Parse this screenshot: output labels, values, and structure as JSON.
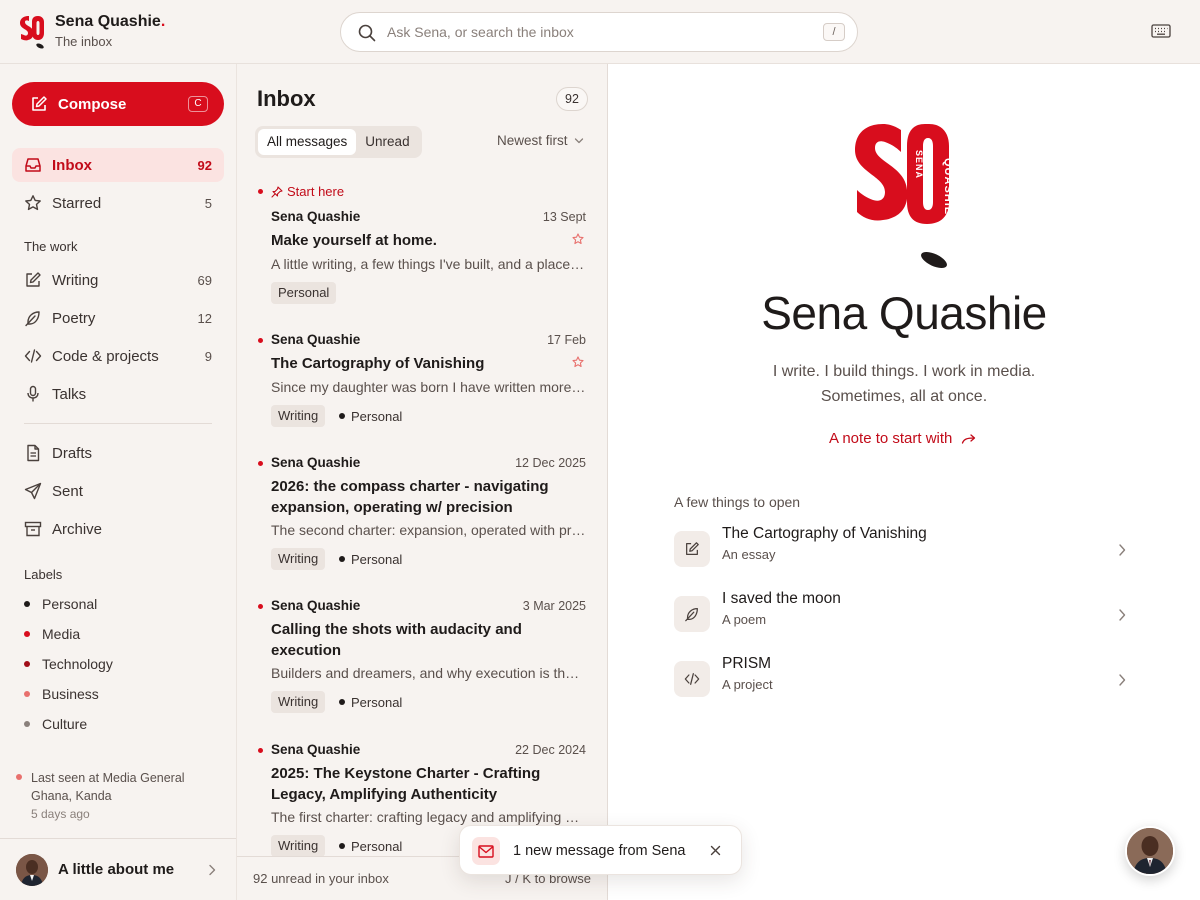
{
  "brand": {
    "name": "Sena Quashie",
    "name_suffix": ".",
    "subtitle": "The inbox",
    "logo_icon": "sq-logo",
    "accent_color": "#d80d1d"
  },
  "search": {
    "placeholder": "Ask Sena, or search the inbox",
    "shortcut": "/"
  },
  "sidebar": {
    "compose_label": "Compose",
    "compose_shortcut": "C",
    "primary": [
      {
        "label": "Inbox",
        "count": "92",
        "icon": "inbox-icon",
        "active": true
      },
      {
        "label": "Starred",
        "count": "5",
        "icon": "star-icon"
      }
    ],
    "work_title": "The work",
    "work": [
      {
        "label": "Writing",
        "count": "69",
        "icon": "pen-icon"
      },
      {
        "label": "Poetry",
        "count": "12",
        "icon": "feather-icon"
      },
      {
        "label": "Code & projects",
        "count": "9",
        "icon": "code-icon"
      },
      {
        "label": "Talks",
        "count": "",
        "icon": "mic-icon"
      }
    ],
    "folders": [
      {
        "label": "Drafts",
        "icon": "file-icon"
      },
      {
        "label": "Sent",
        "icon": "send-icon"
      },
      {
        "label": "Archive",
        "icon": "archive-icon"
      }
    ],
    "labels_title": "Labels",
    "labels": [
      {
        "label": "Personal",
        "color": "#1f1b1a"
      },
      {
        "label": "Media",
        "color": "#d80d1d"
      },
      {
        "label": "Technology",
        "color": "#a10d18"
      },
      {
        "label": "Business",
        "color": "#e8706d"
      },
      {
        "label": "Culture",
        "color": "#8a807b"
      }
    ],
    "last_seen": "Last seen at Media General Ghana, Kanda",
    "last_seen_ago": "5 days ago",
    "about_label": "A little about me"
  },
  "inbox": {
    "title": "Inbox",
    "count": "92",
    "filters": [
      "All messages",
      "Unread"
    ],
    "sort_label": "Newest first",
    "messages": [
      {
        "pin": "Start here",
        "from": "Sena Quashie",
        "date": "13 Sept",
        "subject": "Make yourself at home.",
        "preview": "A little writing, a few things I've built, and a place to start.",
        "starred": true,
        "tags": [
          "Personal"
        ],
        "dot_tags": []
      },
      {
        "from": "Sena Quashie",
        "date": "17 Feb",
        "subject": "The Cartography of Vanishing",
        "preview": "Since my daughter was born I have written more about what disappears.",
        "starred": true,
        "tags": [
          "Writing"
        ],
        "dot_tags": [
          "Personal"
        ]
      },
      {
        "from": "Sena Quashie",
        "date": "12 Dec 2025",
        "subject": "2026: the compass charter - navigating expansion, operating w/ precision",
        "preview": "The second charter: expansion, operated with precision.",
        "tags": [
          "Writing"
        ],
        "dot_tags": [
          "Personal"
        ]
      },
      {
        "from": "Sena Quashie",
        "date": "3 Mar 2025",
        "subject": "Calling the shots with audacity and execution",
        "preview": "Builders and dreamers, and why execution is the whole game.",
        "tags": [
          "Writing"
        ],
        "dot_tags": [
          "Personal"
        ]
      },
      {
        "from": "Sena Quashie",
        "date": "22 Dec 2024",
        "subject": "2025: The Keystone Charter - Crafting Legacy, Amplifying Authenticity",
        "preview": "The first charter: crafting legacy and amplifying authenticity.",
        "tags": [
          "Writing"
        ],
        "dot_tags": [
          "Personal"
        ]
      }
    ],
    "footer_left": "92 unread in your inbox",
    "footer_right": "J / K to browse"
  },
  "pane": {
    "name": "Sena Quashie",
    "tagline_1": "I write. I build things. I work in media.",
    "tagline_2": "Sometimes, all at once.",
    "link_label": "A note to start with",
    "open_title": "A few things to open",
    "open_items": [
      {
        "title": "The Cartography of Vanishing",
        "subtitle": "An essay",
        "icon": "pen-icon"
      },
      {
        "title": "I saved the moon",
        "subtitle": "A poem",
        "icon": "feather-icon"
      },
      {
        "title": "PRISM",
        "subtitle": "A project",
        "icon": "code-icon"
      }
    ]
  },
  "toast": {
    "text": "1 new message from Sena",
    "icon": "mail-icon"
  }
}
